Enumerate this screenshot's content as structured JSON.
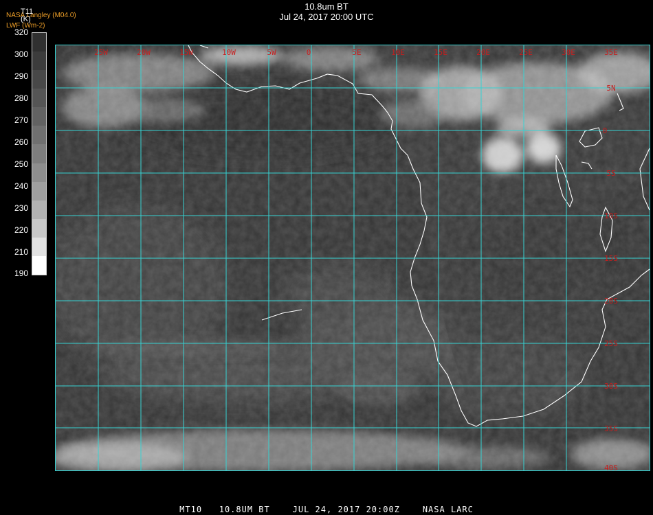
{
  "title_line1": "10.8um BT",
  "title_line2": "Jul 24, 2017 20:00 UTC",
  "credit_line1": "NASA Langley (M04.0)",
  "credit_line2": "LWF (Wm-2)",
  "scale": {
    "title": "T11",
    "unit": "(K)",
    "labels": [
      "320",
      "300",
      "290",
      "280",
      "270",
      "260",
      "250",
      "240",
      "230",
      "220",
      "210",
      "190"
    ],
    "bands": [
      "#303030",
      "#3c3c3c",
      "#484848",
      "#555555",
      "#626262",
      "#707070",
      "#7e7e7e",
      "#8e8e8e",
      "#9f9f9f",
      "#b2b2b2",
      "#c8c8c8",
      "#e2e2e2",
      "#ffffff"
    ]
  },
  "colors": {
    "grid": "#36d3d3",
    "grid_label": "#c81e1e",
    "coast": "#ffffff"
  },
  "lon_labels": [
    "25W",
    "20W",
    "15W",
    "10W",
    "5W",
    "0",
    "5E",
    "10E",
    "15E",
    "20E",
    "25E",
    "30E",
    "35E"
  ],
  "lat_labels": [
    "5N",
    "0",
    "5S",
    "10S",
    "15S",
    "20S",
    "25S",
    "30S",
    "35S",
    "40S"
  ],
  "footer": "MT10   10.8UM BT    JUL 24, 2017 20:00Z    NASA LARC"
}
